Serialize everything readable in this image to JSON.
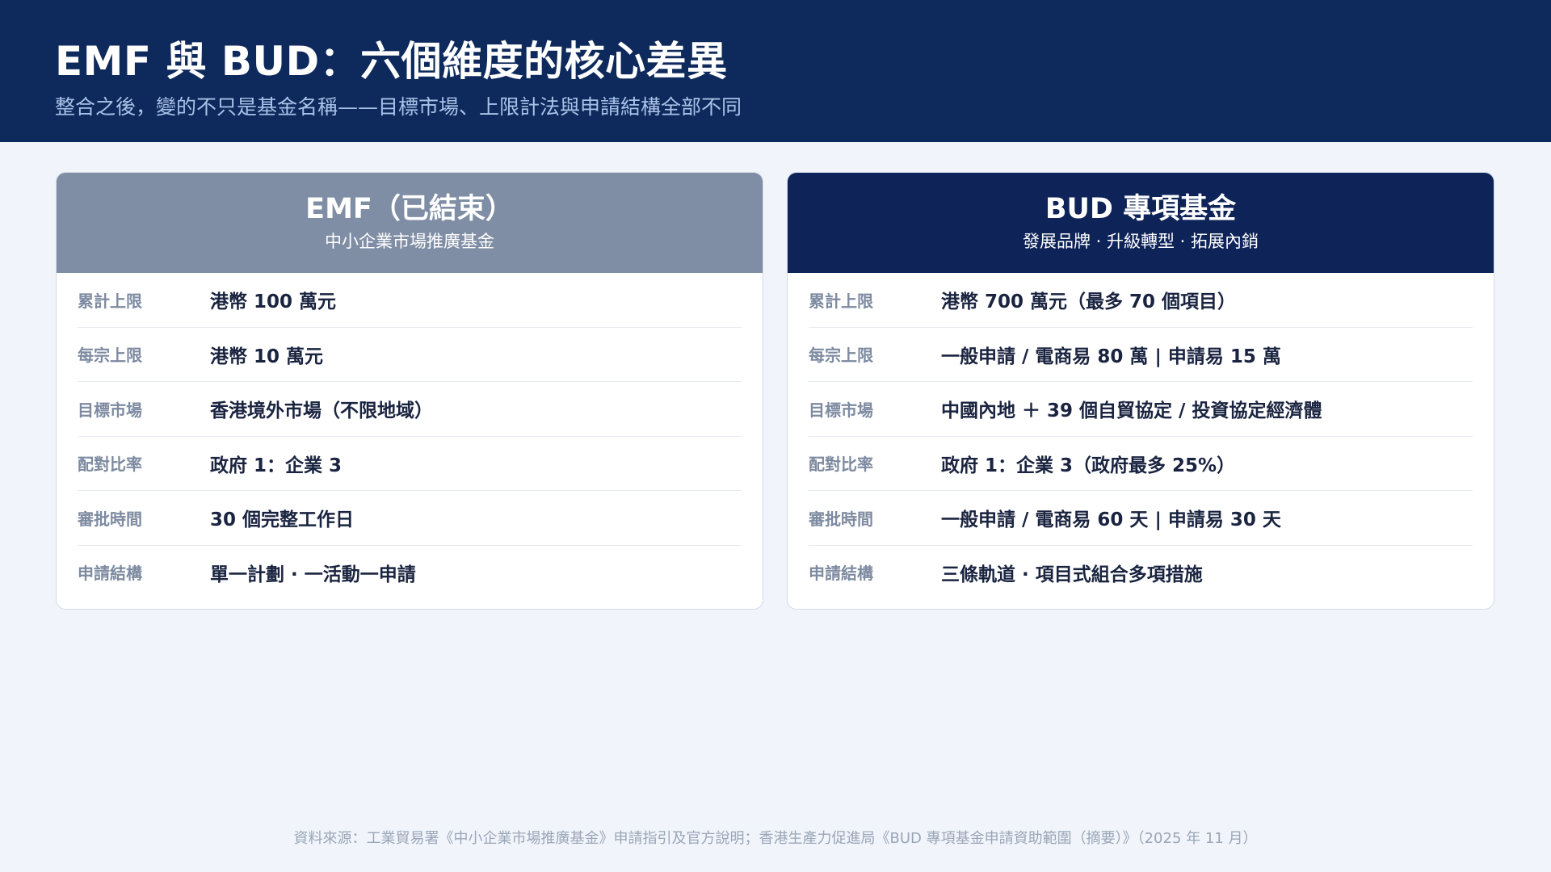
{
  "header": {
    "title": "EMF 與 BUD：六個維度的核心差異",
    "subtitle": "整合之後，變的不只是基金名稱——目標市場、上限計法與申請結構全部不同"
  },
  "cards": {
    "emf": {
      "title": "EMF（已結束）",
      "subtitle": "中小企業市場推廣基金",
      "rows": [
        {
          "label": "累計上限",
          "value": "港幣 100 萬元"
        },
        {
          "label": "每宗上限",
          "value": "港幣 10 萬元"
        },
        {
          "label": "目標市場",
          "value": "香港境外市場（不限地域）"
        },
        {
          "label": "配對比率",
          "value": "政府 1：企業 3"
        },
        {
          "label": "審批時間",
          "value": "30 個完整工作日"
        },
        {
          "label": "申請結構",
          "value": "單一計劃 · 一活動一申請"
        }
      ]
    },
    "bud": {
      "title": "BUD 專項基金",
      "subtitle": "發展品牌 · 升級轉型 · 拓展內銷",
      "rows": [
        {
          "label": "累計上限",
          "value": "港幣 700 萬元（最多 70 個項目）"
        },
        {
          "label": "每宗上限",
          "value": "一般申請 / 電商易 80 萬 | 申請易 15 萬"
        },
        {
          "label": "目標市場",
          "value": "中國內地 ＋ 39 個自貿協定 / 投資協定經濟體"
        },
        {
          "label": "配對比率",
          "value": "政府 1：企業 3（政府最多 25%）"
        },
        {
          "label": "審批時間",
          "value": "一般申請 / 電商易 60 天 | 申請易 30 天"
        },
        {
          "label": "申請結構",
          "value": "三條軌道 · 項目式組合多項措施"
        }
      ]
    }
  },
  "footer": {
    "source": "資料來源：工業貿易署《中小企業市場推廣基金》申請指引及官方說明；香港生產力促進局《BUD 專項基金申請資助範圍（摘要）》（2025 年 11 月）"
  },
  "colors": {
    "header_bg": "#0e2a5c",
    "emf_head_bg": "#7f8ea5",
    "bud_head_bg": "#0e2358",
    "page_bg": "#f1f5fb"
  }
}
